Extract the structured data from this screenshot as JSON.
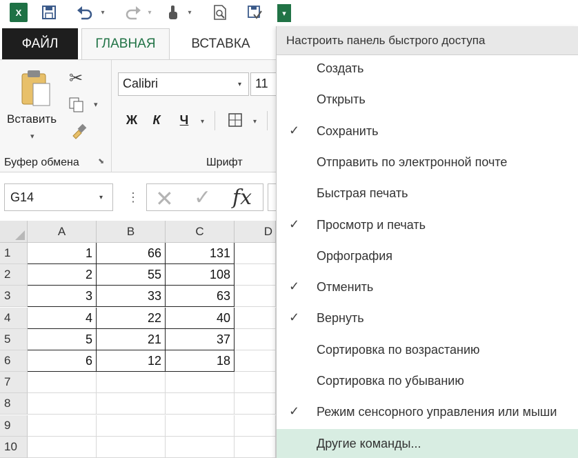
{
  "qat": {
    "app_logo": "X",
    "icons": [
      "excel-logo-icon",
      "save-icon",
      "undo-icon",
      "redo-icon",
      "touch-mode-icon",
      "print-preview-icon",
      "spellcheck-icon",
      "customize-dropdown-icon"
    ]
  },
  "tabs": {
    "file": "ФАЙЛ",
    "home": "ГЛАВНАЯ",
    "insert": "ВСТАВКА"
  },
  "ribbon": {
    "paste_label": "Вставить",
    "clipboard_group": "Буфер обмена",
    "font_group": "Шрифт",
    "font_name": "Calibri",
    "font_size": "11",
    "bold": "Ж",
    "italic": "К",
    "underline": "Ч"
  },
  "formula_bar": {
    "namebox": "G14",
    "fx": "fx"
  },
  "grid": {
    "columns": [
      "A",
      "B",
      "C",
      "D"
    ],
    "rows": [
      {
        "n": "1",
        "a": "1",
        "b": "66",
        "c": "131"
      },
      {
        "n": "2",
        "a": "2",
        "b": "55",
        "c": "108"
      },
      {
        "n": "3",
        "a": "3",
        "b": "33",
        "c": "63"
      },
      {
        "n": "4",
        "a": "4",
        "b": "22",
        "c": "40"
      },
      {
        "n": "5",
        "a": "5",
        "b": "21",
        "c": "37"
      },
      {
        "n": "6",
        "a": "6",
        "b": "12",
        "c": "18"
      },
      {
        "n": "7",
        "a": "",
        "b": "",
        "c": ""
      },
      {
        "n": "8",
        "a": "",
        "b": "",
        "c": ""
      },
      {
        "n": "9",
        "a": "",
        "b": "",
        "c": ""
      },
      {
        "n": "10",
        "a": "",
        "b": "",
        "c": ""
      }
    ]
  },
  "menu": {
    "header": "Настроить панель быстрого доступа",
    "items": [
      {
        "label": "Создать",
        "checked": false
      },
      {
        "label": "Открыть",
        "checked": false
      },
      {
        "label": "Сохранить",
        "checked": true
      },
      {
        "label": "Отправить по электронной почте",
        "checked": false
      },
      {
        "label": "Быстрая печать",
        "checked": false
      },
      {
        "label": "Просмотр и печать",
        "checked": true
      },
      {
        "label": "Орфография",
        "checked": false
      },
      {
        "label": "Отменить",
        "checked": true
      },
      {
        "label": "Вернуть",
        "checked": true
      },
      {
        "label": "Сортировка по возрастанию",
        "checked": false
      },
      {
        "label": "Сортировка по убыванию",
        "checked": false
      },
      {
        "label": "Режим сенсорного управления или мыши",
        "checked": true
      },
      {
        "label": "Другие команды...",
        "checked": false,
        "highlighted": true
      }
    ],
    "check_mark": "✓"
  },
  "colors": {
    "excel_green": "#217346",
    "file_tab": "#1e1e1e",
    "menu_hover": "#d8ede2"
  }
}
